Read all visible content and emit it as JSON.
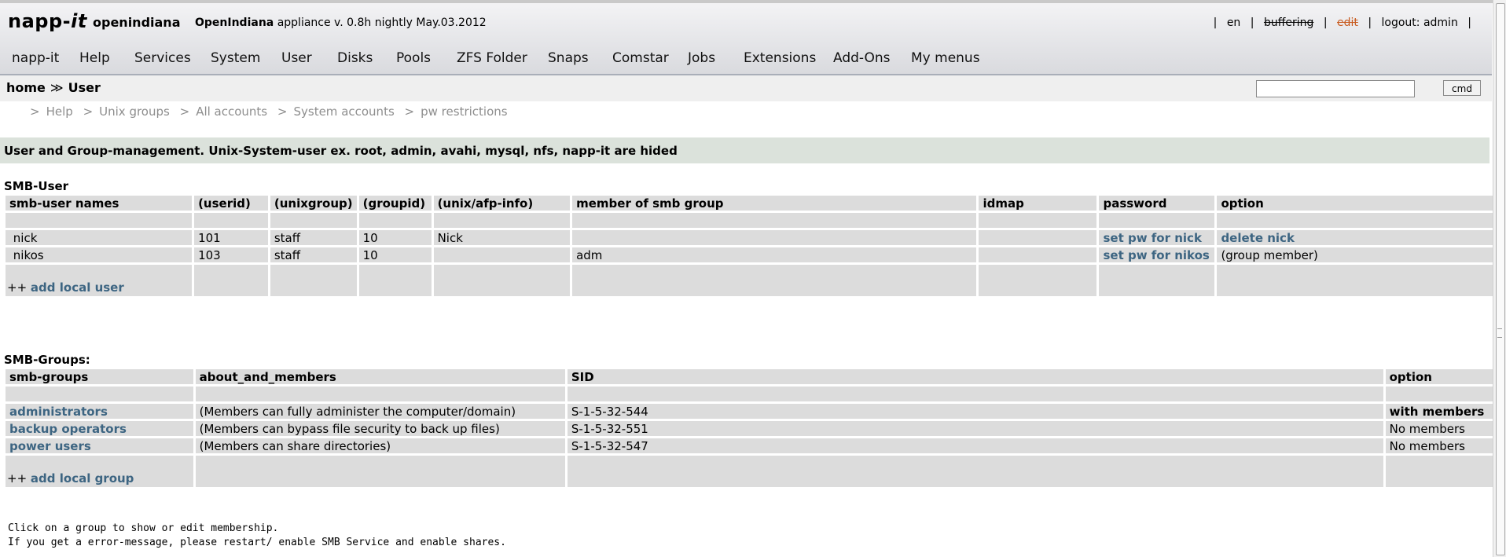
{
  "header": {
    "brand_main": "napp-",
    "brand_italic": "it",
    "hostname": "openindiana",
    "appliance_os": "OpenIndiana",
    "appliance_rest": "appliance v. 0.8h nightly May.03.2012",
    "links": {
      "sep1": "|",
      "lang": "en",
      "sep2": "|",
      "buffering": "buffering",
      "sep3": "|",
      "edit": "edit",
      "sep4": "|",
      "logout": "logout: admin",
      "sep5": "|"
    }
  },
  "menu": [
    "napp-it",
    "Help",
    "Services",
    "System",
    "User",
    "Disks",
    "Pools",
    "ZFS Folder",
    "Snaps",
    "Comstar",
    "Jobs",
    "Extensions",
    "Add-Ons",
    "My menus"
  ],
  "breadcrumb": {
    "home": "home",
    "sep": "≫",
    "current": "User"
  },
  "cmd": {
    "button": "cmd",
    "value": ""
  },
  "subnav": {
    "gt": ">",
    "items": [
      "Help",
      "Unix groups",
      "All accounts",
      "System accounts",
      "pw restrictions"
    ]
  },
  "info": "User and Group-management. Unix-System-user ex. root, admin, avahi, mysql, nfs, napp-it are hided",
  "smb_user": {
    "title": "SMB-User",
    "headers": [
      "smb-user names",
      "(userid)",
      "(unixgroup)",
      "(groupid)",
      "(unix/afp-info)",
      "member of smb group",
      "idmap",
      "password",
      "option"
    ],
    "rows": [
      {
        "name": "nick",
        "userid": "101",
        "unixgroup": "staff",
        "groupid": "10",
        "info": "Nick",
        "member": "",
        "idmap": "",
        "password": "set pw for nick",
        "option": "delete nick"
      },
      {
        "name": "nikos",
        "userid": "103",
        "unixgroup": "staff",
        "groupid": "10",
        "info": "",
        "member": "adm",
        "idmap": "",
        "password": "set pw for nikos",
        "option": "(group member)"
      }
    ],
    "add_prefix": "++",
    "add_label": "add local user"
  },
  "smb_groups": {
    "title": "SMB-Groups:",
    "headers": [
      "smb-groups",
      "about_and_members",
      "SID",
      "option"
    ],
    "rows": [
      {
        "name": "administrators",
        "about": "(Members can fully administer the computer/domain)",
        "sid": "S-1-5-32-544",
        "option": "with members"
      },
      {
        "name": "backup operators",
        "about": "(Members can bypass file security to back up files)",
        "sid": "S-1-5-32-551",
        "option": "No members"
      },
      {
        "name": "power users",
        "about": "(Members can share directories)",
        "sid": "S-1-5-32-547",
        "option": "No members"
      }
    ],
    "add_prefix": "++",
    "add_label": "add local group"
  },
  "help": [
    "Click on a group to show or edit membership.",
    "If you get a error-message, please restart/ enable SMB Service and enable shares."
  ]
}
